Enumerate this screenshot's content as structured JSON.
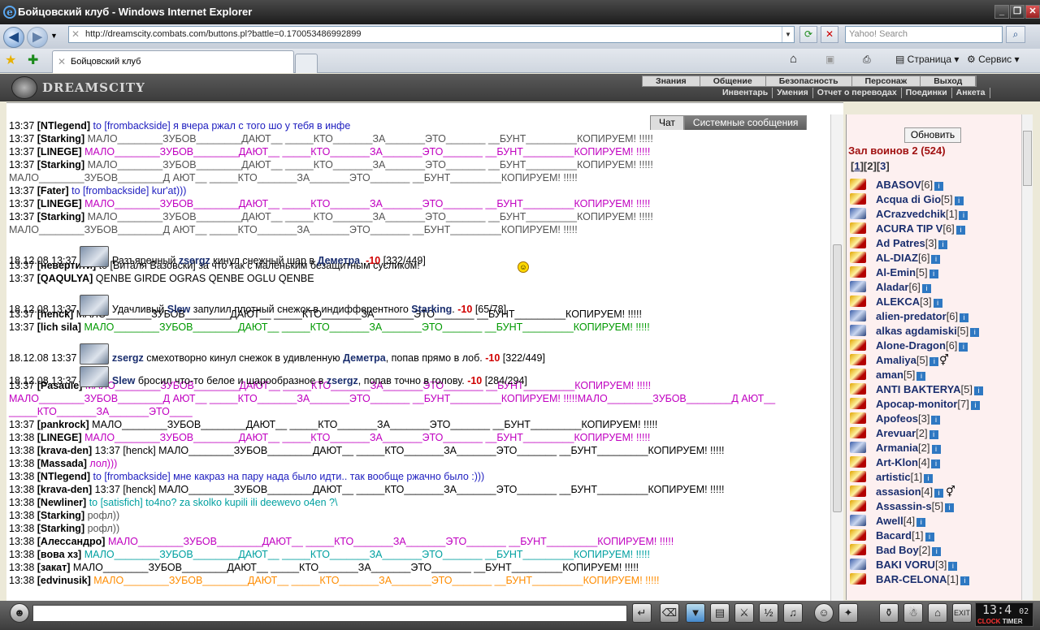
{
  "window": {
    "title": "Бойцовский клуб - Windows Internet Explorer"
  },
  "browser": {
    "url": "http://dreamscity.combats.com/buttons.pl?battle=0.170053486992899",
    "search_placeholder": "Yahoo! Search",
    "tab_title": "Бойцовский клуб",
    "tools": {
      "page": "Страница",
      "service": "Сервис"
    }
  },
  "game": {
    "logo": "DREAMSCITY",
    "menu_top": [
      "Знания",
      "Общение",
      "Безопасность",
      "Персонаж",
      "Выход"
    ],
    "menu_bottom": [
      "Инвентарь",
      "Умения",
      "Отчет о переводах",
      "Поединки",
      "Анкета"
    ]
  },
  "chat": {
    "tab_chat": "Чат",
    "tab_system": "Системные сообщения",
    "lines": [
      {
        "t": "13:37",
        "n": "[NTlegend]",
        "m": "to [frombackside] я вчера ржал с того шо у тебя в инфе",
        "c": "c-blue"
      },
      {
        "t": "13:37",
        "n": "[Starking]",
        "m": "МАЛО________ЗУБОВ________ДАЮТ__ _____КТО_______ЗА_______ЭТО_______ __БУНТ_________КОПИРУЕМ! !!!!!",
        "c": "c-gray"
      },
      {
        "t": "13:37",
        "n": "[LINEGE]",
        "m": "МАЛО________ЗУБОВ________ДАЮТ__ _____КТО_______ЗА_______ЭТО_______ __БУНТ_________КОПИРУЕМ! !!!!!",
        "c": "c-mag"
      },
      {
        "t": "13:37",
        "n": "[Starking]",
        "m": "МАЛО________ЗУБОВ________ДАЮТ__ _____КТО_______ЗА_______ЭТО_______ __БУНТ_________КОПИРУЕМ! !!!!!",
        "c": "c-gray"
      },
      {
        "t": "",
        "n": "",
        "m": "МАЛО________ЗУБОВ________Д АЮТ__ _____КТО_______ЗА_______ЭТО_______ __БУНТ_________КОПИРУЕМ! !!!!!",
        "c": "c-gray"
      },
      {
        "t": "13:37",
        "n": "[Fater]",
        "m": "to [frombackside] kur'at)))",
        "c": "c-blue"
      },
      {
        "t": "13:37",
        "n": "[LINEGE]",
        "m": "МАЛО________ЗУБОВ________ДАЮТ__ _____КТО_______ЗА_______ЭТО_______ __БУНТ_________КОПИРУЕМ! !!!!!",
        "c": "c-mag"
      },
      {
        "t": "13:37",
        "n": "[Starking]",
        "m": "МАЛО________ЗУБОВ________ДАЮТ__ _____КТО_______ЗА_______ЭТО_______ __БУНТ_________КОПИРУЕМ! !!!!!",
        "c": "c-gray"
      },
      {
        "t": "",
        "n": "",
        "m": "МАЛО________ЗУБОВ________Д АЮТ__ _____КТО_______ЗА_______ЭТО_______ __БУНТ_________КОПИРУЕМ! !!!!!",
        "c": "c-gray"
      }
    ],
    "event1": {
      "t": "18.12.08 13:37",
      "pre": "Разъяренный",
      "a": "zsergz",
      "mid": "кинул снежный шар в",
      "b": "Деметра",
      "end": ".",
      "dmg": "-10",
      "hp": "[332/449]"
    },
    "lines2": [
      {
        "t": "13:37",
        "n": "[невертити]",
        "m": "to [Виталя Вазовски] за что так с маленьким безащитным сусликом!",
        "c": ""
      },
      {
        "t": "13:37",
        "n": "[QAQULYA]",
        "m": "QENBE GIRDE OGRAS QENBE OGLU QENBE",
        "c": ""
      }
    ],
    "event2": {
      "t": "18.12.08 13:37",
      "pre": "Удачливый",
      "a": "Slew",
      "mid": "запулил плотный снежок в индифферентного",
      "b": "Starking",
      "end": ".",
      "dmg": "-10",
      "hp": "[65/78]"
    },
    "lines3": [
      {
        "t": "13:37",
        "n": "[henck]",
        "m": "МАЛО________ЗУБОВ________ДАЮТ__ _____КТО_______ЗА_______ЭТО_______ __БУНТ_________КОПИРУЕМ! !!!!!",
        "c": ""
      },
      {
        "t": "13:37",
        "n": "[lich sila]",
        "m": "МАЛО________ЗУБОВ________ДАЮТ__ _____КТО_______ЗА_______ЭТО_______ __БУНТ_________КОПИРУЕМ! !!!!!",
        "c": "c-green"
      }
    ],
    "event3": {
      "t": "18.12.08 13:37",
      "pre": "",
      "a": "zsergz",
      "mid": "смехотворно кинул снежок в удивленную",
      "b": "Деметра",
      "end": ", попав прямо в лоб.",
      "dmg": "-10",
      "hp": "[322/449]"
    },
    "event4": {
      "t": "18.12.08 13:37",
      "pre": "",
      "a": "Slew",
      "mid": "бросил что-то белое и шарообразное в",
      "b": "zsergz",
      "end": ", попав точно в голову.",
      "dmg": "-10",
      "hp": "[284/294]"
    },
    "lines4": [
      {
        "t": "13:37",
        "n": "[Pasaule]",
        "m": "МАЛО________ЗУБОВ________ДАЮТ__ _____КТО_______ЗА_______ЭТО_______ __БУНТ_________КОПИРУЕМ! !!!!!",
        "c": "c-mag"
      }
    ],
    "wrap_line": "МАЛО________ЗУБОВ________Д АЮТ__ _____КТО_______ЗА_______ЭТО_______ __БУНТ_________КОПИРУЕМ! !!!!!МАЛО________ЗУБОВ________Д АЮТ__ _____КТО_______ЗА_______ЭТО____",
    "lines5": [
      {
        "t": "13:37",
        "n": "[pankrock]",
        "m": "МАЛО________ЗУБОВ________ДАЮТ__ _____КТО_______ЗА_______ЭТО_______ __БУНТ_________КОПИРУЕМ! !!!!!",
        "c": ""
      },
      {
        "t": "13:38",
        "n": "[LINEGE]",
        "m": "МАЛО________ЗУБОВ________ДАЮТ__ _____КТО_______ЗА_______ЭТО_______ __БУНТ_________КОПИРУЕМ! !!!!!",
        "c": "c-mag"
      },
      {
        "t": "13:38",
        "n": "[krava-den]",
        "m": "13:37 [henck] МАЛО________ЗУБОВ________ДАЮТ__ _____КТО_______ЗА_______ЭТО_______ __БУНТ_________КОПИРУЕМ! !!!!!",
        "c": ""
      },
      {
        "t": "13:38",
        "n": "[Massada]",
        "m": "лол)))",
        "c": "c-mag"
      },
      {
        "t": "13:38",
        "n": "[NTlegend]",
        "m": "to [frombackside] мне какраз на пару нада было идти.. так вообще ржачно было :)))",
        "c": "c-blue"
      },
      {
        "t": "13:38",
        "n": "[krava-den]",
        "m": "13:37 [henck] МАЛО________ЗУБОВ________ДАЮТ__ _____КТО_______ЗА_______ЭТО_______ __БУНТ_________КОПИРУЕМ! !!!!!",
        "c": ""
      },
      {
        "t": "13:38",
        "n": "[Newliner]",
        "m": "to [satisfich] to4no? za skolko kupili ili deewevo o4en ?\\",
        "c": "c-teal"
      },
      {
        "t": "13:38",
        "n": "[Starking]",
        "m": "рофл))",
        "c": "c-gray"
      },
      {
        "t": "13:38",
        "n": "[Starking]",
        "m": "рофл))",
        "c": "c-gray"
      },
      {
        "t": "13:38",
        "n": "[Алессандро]",
        "m": "МАЛО________ЗУБОВ________ДАЮТ__ _____КТО_______ЗА_______ЭТО_______ __БУНТ_________КОПИРУЕМ! !!!!!",
        "c": "c-mag"
      },
      {
        "t": "13:38",
        "n": "[вова хз]",
        "m": "МАЛО________ЗУБОВ________ДАЮТ__ _____КТО_______ЗА_______ЭТО_______ __БУНТ_________КОПИРУЕМ! !!!!!",
        "c": "c-teal"
      },
      {
        "t": "13:38",
        "n": "[закат]",
        "m": "МАЛО________ЗУБОВ________ДАЮТ__ _____КТО_______ЗА_______ЭТО_______ __БУНТ_________КОПИРУЕМ! !!!!!",
        "c": ""
      },
      {
        "t": "13:38",
        "n": "[edvinusik]",
        "m": "МАЛО________ЗУБОВ________ДАЮТ__ _____КТО_______ЗА_______ЭТО_______ __БУНТ_________КОПИРУЕМ! !!!!!",
        "c": "c-orange"
      }
    ]
  },
  "sidebar": {
    "refresh": "Обновить",
    "hall": "Зал воинов 2 (524)",
    "pages": [
      "1",
      "2",
      "3"
    ],
    "players": [
      {
        "name": "ABASOV",
        "lvl": "[6]",
        "icon": "a"
      },
      {
        "name": "Acqua di Gio",
        "lvl": "[5]",
        "icon": "a"
      },
      {
        "name": "ACrazvedchik",
        "lvl": "[1]",
        "icon": "b"
      },
      {
        "name": "ACURA TIP V",
        "lvl": "[6]",
        "icon": "a"
      },
      {
        "name": "Ad Patres",
        "lvl": "[3]",
        "icon": "a"
      },
      {
        "name": "AL-DIAZ",
        "lvl": "[6]",
        "icon": "a"
      },
      {
        "name": "Al-Emin",
        "lvl": "[5]",
        "icon": "a"
      },
      {
        "name": "Aladar",
        "lvl": "[6]",
        "icon": "b"
      },
      {
        "name": "ALEKCA",
        "lvl": "[3]",
        "icon": "a"
      },
      {
        "name": "alien-predator",
        "lvl": "[6]",
        "icon": "b"
      },
      {
        "name": "alkas agdamiski",
        "lvl": "[5]",
        "icon": "b"
      },
      {
        "name": "Alone-Dragon",
        "lvl": "[6]",
        "icon": "a"
      },
      {
        "name": "Amaliya",
        "lvl": "[5]",
        "icon": "a",
        "g": "⚥"
      },
      {
        "name": "aman",
        "lvl": "[5]",
        "icon": "a"
      },
      {
        "name": "ANTI BAKTERYA",
        "lvl": "[5]",
        "icon": "a"
      },
      {
        "name": "Apocap-monitor",
        "lvl": "[7]",
        "icon": "a"
      },
      {
        "name": "Apofeos",
        "lvl": "[3]",
        "icon": "a"
      },
      {
        "name": "Arevuar",
        "lvl": "[2]",
        "icon": "a"
      },
      {
        "name": "Armania",
        "lvl": "[2]",
        "icon": "b"
      },
      {
        "name": "Art-Klon",
        "lvl": "[4]",
        "icon": "a"
      },
      {
        "name": "artistic",
        "lvl": "[1]",
        "icon": "a"
      },
      {
        "name": "assasion",
        "lvl": "[4]",
        "icon": "a",
        "g": "⚥"
      },
      {
        "name": "Assassin-s",
        "lvl": "[5]",
        "icon": "a"
      },
      {
        "name": "Awell",
        "lvl": "[4]",
        "icon": "b"
      },
      {
        "name": "Bacard",
        "lvl": "[1]",
        "icon": "a"
      },
      {
        "name": "Bad Boy",
        "lvl": "[2]",
        "icon": "a"
      },
      {
        "name": "BAKI VORU",
        "lvl": "[3]",
        "icon": "b"
      },
      {
        "name": "BAR-CELONA",
        "lvl": "[1]",
        "icon": "a"
      }
    ]
  },
  "bottom": {
    "clock": "13:4",
    "clock_sec": "02",
    "clock_label": "CLOCK",
    "timer_label": "TIMER"
  }
}
